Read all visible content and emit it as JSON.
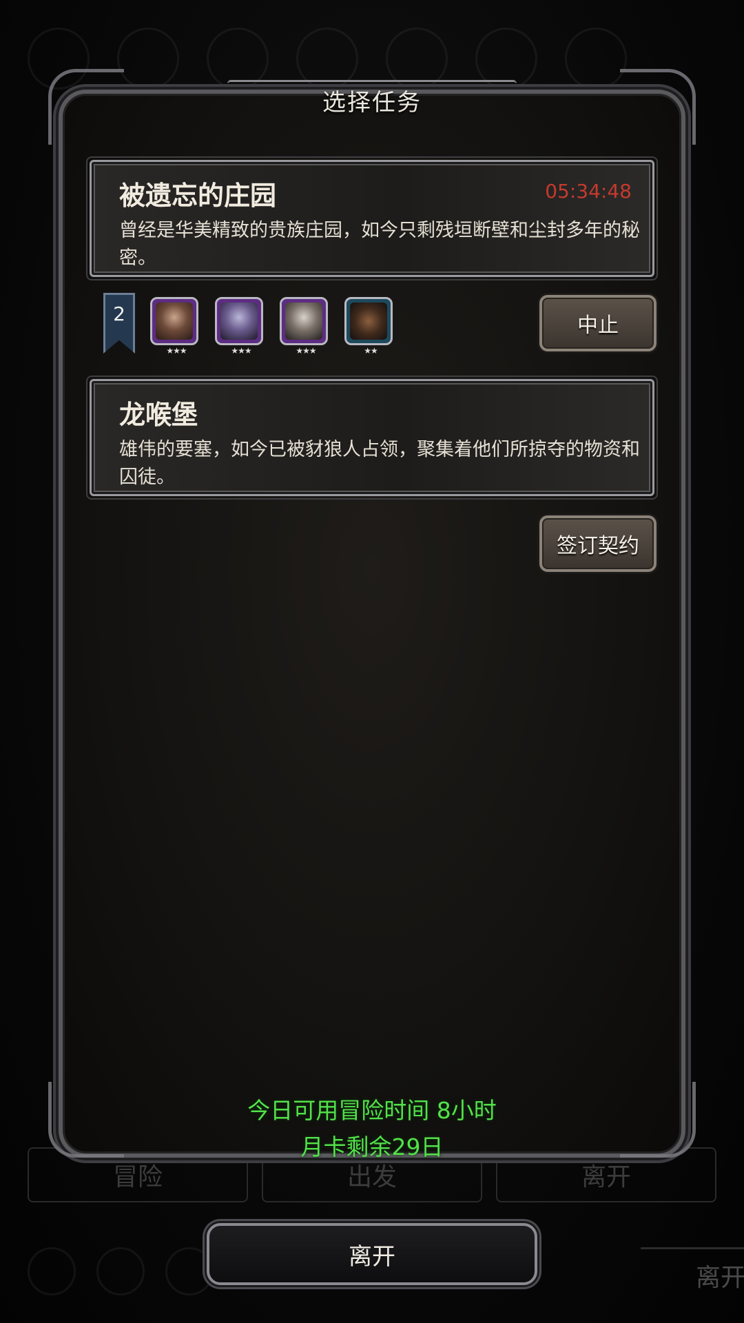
{
  "modal": {
    "title": "选择任务"
  },
  "quests": [
    {
      "name": "被遗忘的庄园",
      "timer": "05:34:48",
      "description": "曾经是华美精致的贵族庄园，如今只剩残垣断壁和尘封多年的秘密。"
    },
    {
      "name": "龙喉堡",
      "description": "雄伟的要塞，如今已被豺狼人占领，聚集着他们所掠夺的物资和囚徒。"
    }
  ],
  "team": {
    "level": "2",
    "heroes": [
      {
        "icon": "hero-portrait-1",
        "stars": "★★★",
        "frame_color": "#5d2c83"
      },
      {
        "icon": "hero-portrait-2",
        "stars": "★★★",
        "frame_color": "#5d2c83"
      },
      {
        "icon": "hero-portrait-3",
        "stars": "★★★",
        "frame_color": "#5d2c83"
      },
      {
        "icon": "hero-portrait-4",
        "stars": "★★",
        "frame_color": "#1d4a5c"
      }
    ]
  },
  "buttons": {
    "abort": "中止",
    "sign_contract": "签订契约",
    "leave": "离开"
  },
  "status": {
    "adventure_time": "今日可用冒险时间 8小时",
    "monthly_card": "月卡剩余29日",
    "color": "#53e14a"
  },
  "background_tabs": [
    "冒险",
    "出发",
    "离开"
  ],
  "background_leave": "离开",
  "colors": {
    "timer": "#c43a2e",
    "status_text": "#53e14a"
  }
}
